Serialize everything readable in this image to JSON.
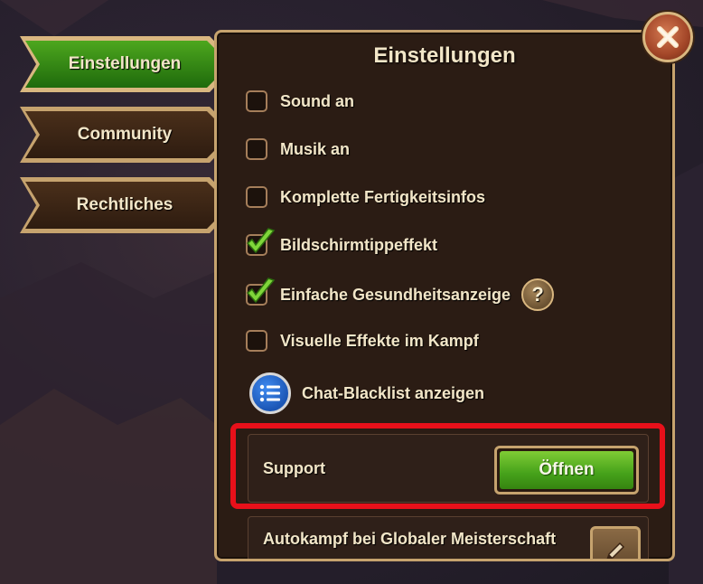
{
  "tabs": [
    {
      "label": "Einstellungen",
      "active": true
    },
    {
      "label": "Community",
      "active": false
    },
    {
      "label": "Rechtliches",
      "active": false
    }
  ],
  "panel": {
    "title": "Einstellungen",
    "options": [
      {
        "label": "Sound an",
        "checked": false
      },
      {
        "label": "Musik an",
        "checked": false
      },
      {
        "label": "Komplette Fertigkeitsinfos",
        "checked": false
      },
      {
        "label": "Bildschirmtippeffekt",
        "checked": true
      },
      {
        "label": "Einfache Gesundheitsanzeige",
        "checked": true,
        "help": "?"
      },
      {
        "label": "Visuelle Effekte im Kampf",
        "checked": false
      }
    ],
    "blacklist_label": "Chat-Blacklist anzeigen",
    "support": {
      "label": "Support",
      "button": "Öffnen"
    },
    "autokampf": {
      "label": "Autokampf bei Globaler Meisterschaft"
    }
  },
  "colors": {
    "accent_green": "#45a11a",
    "highlight_red": "#e8101a",
    "panel_border": "#c6a36e",
    "text": "#f2e6c8"
  },
  "icons": [
    "close-icon",
    "checkmark-icon",
    "question-icon",
    "list-icon",
    "pencil-icon"
  ]
}
